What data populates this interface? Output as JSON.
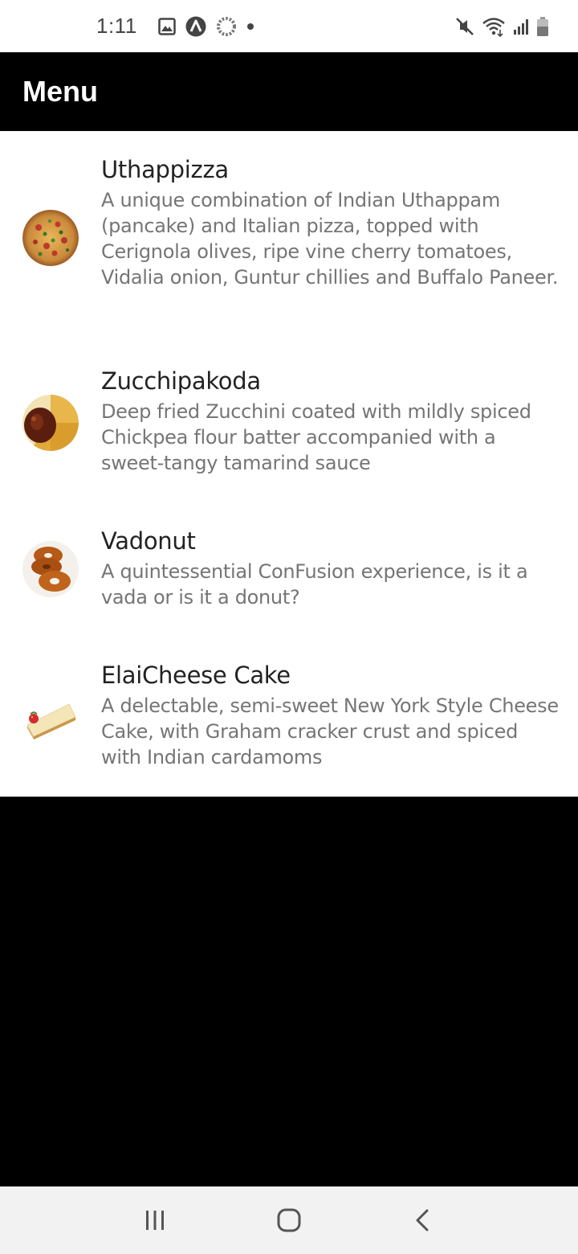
{
  "status_bar": {
    "time": "1:11",
    "left_icons": [
      "image-icon",
      "app-a-icon",
      "loading-ring-icon",
      "dot-icon"
    ],
    "right_icons": [
      "mute-icon",
      "wifi-icon",
      "signal-icon",
      "battery-icon"
    ]
  },
  "app_bar": {
    "title": "Menu"
  },
  "menu": {
    "items": [
      {
        "name": "Uthappizza",
        "description": "A unique combination of Indian Uthappam (pancake) and Italian pizza, topped with Cerignola olives, ripe vine cherry tomatoes, Vidalia onion, Guntur chillies and Buffalo Paneer.",
        "image_icon": "pizza-thumbnail"
      },
      {
        "name": "Zucchipakoda",
        "description": "Deep fried Zucchini coated with mildly spiced Chickpea flour batter accompanied with a sweet-tangy tamarind sauce",
        "image_icon": "pakoda-thumbnail"
      },
      {
        "name": "Vadonut",
        "description": "A quintessential ConFusion experience, is it a vada or is it a donut?",
        "image_icon": "vadonut-thumbnail"
      },
      {
        "name": "ElaiCheese Cake",
        "description": "A delectable, semi-sweet New York Style Cheese Cake, with Graham cracker crust and spiced with Indian cardamoms",
        "image_icon": "cheesecake-thumbnail"
      }
    ]
  },
  "nav_bar": {
    "buttons": [
      "recent-apps-icon",
      "home-icon",
      "back-icon"
    ]
  },
  "colors": {
    "app_bar_bg": "#000000",
    "list_bg": "#ffffff",
    "title_text": "#222222",
    "desc_text": "#757575",
    "nav_bar_bg": "#f2f2f2"
  }
}
